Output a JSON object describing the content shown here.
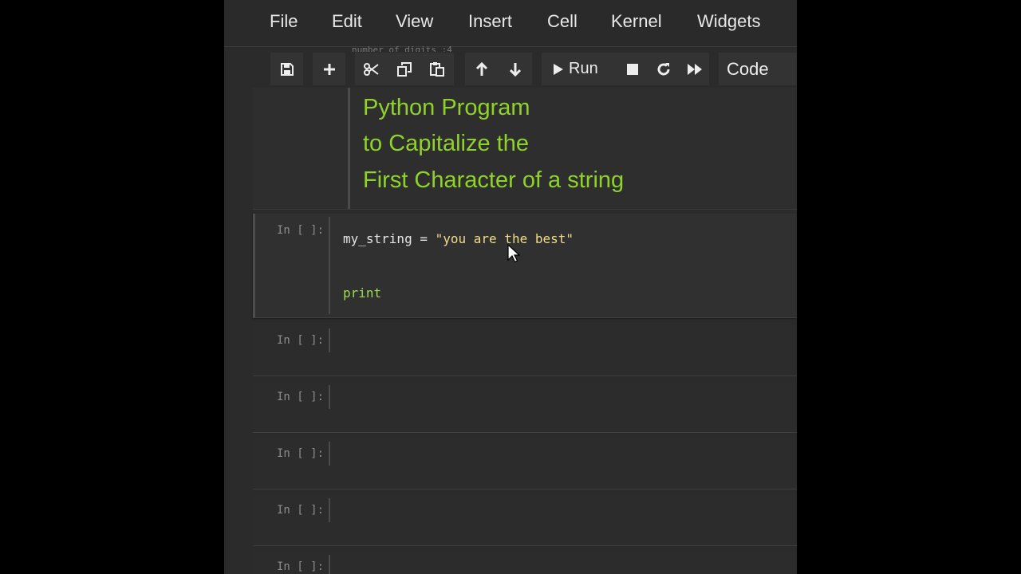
{
  "menubar": {
    "items": [
      "File",
      "Edit",
      "View",
      "Insert",
      "Cell",
      "Kernel",
      "Widgets"
    ]
  },
  "ghost_text": "number of digits :4",
  "toolbar": {
    "run_label": "Run",
    "cell_type": "Code",
    "icons": [
      "save-icon",
      "plus-icon",
      "scissors-icon",
      "copy-icon",
      "paste-icon",
      "arrow-up-icon",
      "arrow-down-icon",
      "play-icon",
      "stop-icon",
      "restart-icon",
      "fast-forward-icon"
    ]
  },
  "markdown_cell": {
    "lines": [
      "Python Program",
      "to Capitalize the",
      "First Character of a string"
    ],
    "color": "#8fd32a"
  },
  "code_cell": {
    "prompt": "In [ ]:",
    "line1": {
      "var": "my_string",
      "op": " = ",
      "str": "\"you are the best\""
    },
    "line2": "print"
  },
  "empty_cells": [
    {
      "prompt": "In [ ]:"
    },
    {
      "prompt": "In [ ]:"
    },
    {
      "prompt": "In [ ]:"
    },
    {
      "prompt": "In [ ]:"
    },
    {
      "prompt": "In [ ]:"
    }
  ]
}
